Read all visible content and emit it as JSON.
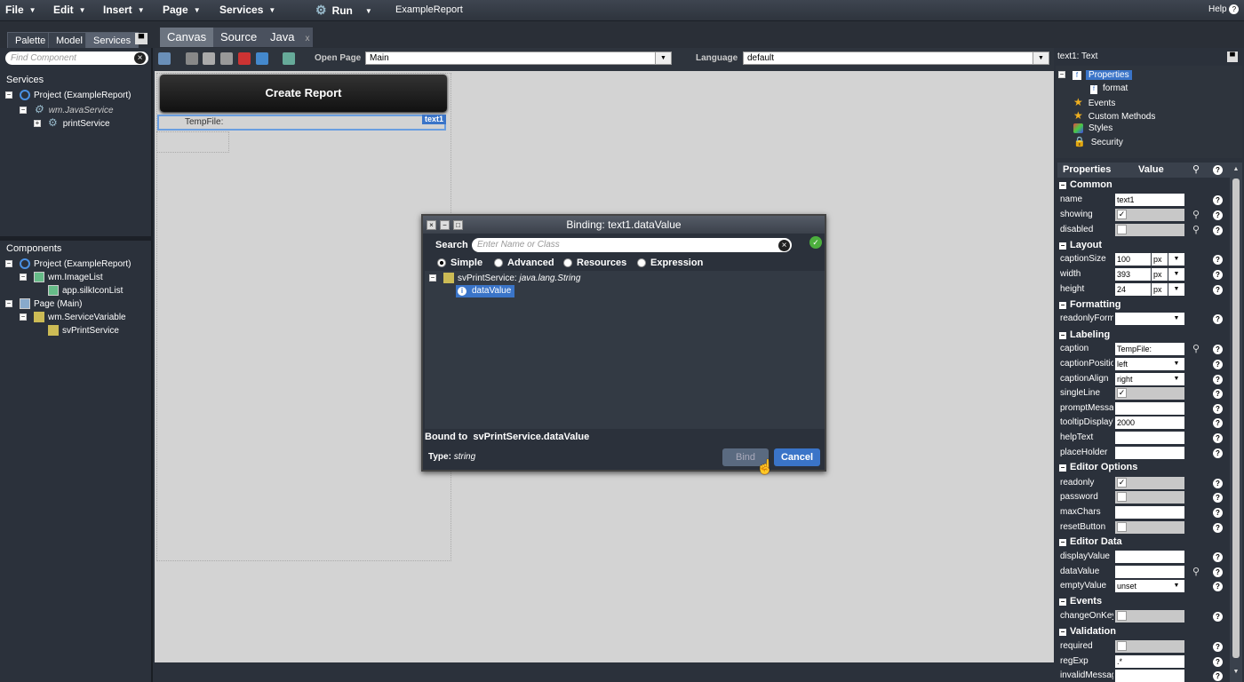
{
  "menu": {
    "file": "File",
    "edit": "Edit",
    "insert": "Insert",
    "page": "Page",
    "services": "Services",
    "run": "Run",
    "project": "ExampleReport",
    "help": "Help"
  },
  "left_tabs": {
    "palette": "Palette",
    "model": "Model",
    "services": "Services"
  },
  "editor_tabs": {
    "canvas": "Canvas",
    "source": "Source",
    "java": "Java"
  },
  "left_panel": {
    "search_placeholder": "Find Component",
    "services_title": "Services",
    "services_tree": [
      "Project (ExampleReport)",
      "wm.JavaService",
      "printService"
    ],
    "components_title": "Components",
    "components_tree": [
      "Project (ExampleReport)",
      "wm.ImageList",
      "app.silkIconList",
      "Page (Main)",
      "wm.ServiceVariable",
      "svPrintService"
    ]
  },
  "toolbar": {
    "open_page_label": "Open Page",
    "open_page_value": "Main",
    "language_label": "Language",
    "language_value": "default"
  },
  "canvas": {
    "create_button": "Create Report",
    "field_caption": "TempFile:",
    "field_tag": "text1"
  },
  "dialog": {
    "title": "Binding: text1.dataValue",
    "search_label": "Search",
    "search_placeholder": "Enter Name or Class",
    "modes": [
      "Simple",
      "Advanced",
      "Resources",
      "Expression"
    ],
    "selected_mode": "Simple",
    "tree_root": "svPrintService:",
    "tree_root_type": "java.lang.String",
    "tree_child": "dataValue",
    "bound_to_label": "Bound to",
    "bound_to_value": "svPrintService.dataValue",
    "type_label": "Type:",
    "type_value": "string",
    "bind_label": "Bind",
    "cancel_label": "Cancel"
  },
  "right_panel": {
    "title": "text1: Text",
    "tree": [
      "Properties",
      "format",
      "Events",
      "Custom Methods",
      "Styles",
      "Security"
    ],
    "header_properties": "Properties",
    "header_value": "Value",
    "groups": {
      "common": "Common",
      "layout": "Layout",
      "formatting": "Formatting",
      "labeling": "Labeling",
      "editor_options": "Editor Options",
      "editor_data": "Editor Data",
      "events": "Events",
      "validation": "Validation"
    },
    "props": {
      "name": {
        "label": "name",
        "value": "text1"
      },
      "showing": {
        "label": "showing",
        "value": "✓"
      },
      "disabled": {
        "label": "disabled",
        "value": ""
      },
      "captionSize": {
        "label": "captionSize",
        "value": "100",
        "unit": "px"
      },
      "width": {
        "label": "width",
        "value": "393",
        "unit": "px"
      },
      "height": {
        "label": "height",
        "value": "24",
        "unit": "px"
      },
      "readonlyFormatter": {
        "label": "readonlyForma",
        "value": ""
      },
      "caption": {
        "label": "caption",
        "value": "TempFile:"
      },
      "captionPosition": {
        "label": "captionPosition",
        "value": "left"
      },
      "captionAlign": {
        "label": "captionAlign",
        "value": "right"
      },
      "singleLine": {
        "label": "singleLine",
        "value": "✓"
      },
      "promptMessage": {
        "label": "promptMessag",
        "value": ""
      },
      "tooltipDisplayTime": {
        "label": "tooltipDisplayTi",
        "value": "2000"
      },
      "helpText": {
        "label": "helpText",
        "value": ""
      },
      "placeHolder": {
        "label": "placeHolder",
        "value": ""
      },
      "readonly": {
        "label": "readonly",
        "value": "✓"
      },
      "password": {
        "label": "password",
        "value": ""
      },
      "maxChars": {
        "label": "maxChars",
        "value": ""
      },
      "resetButton": {
        "label": "resetButton",
        "value": ""
      },
      "displayValue": {
        "label": "displayValue",
        "value": ""
      },
      "dataValue": {
        "label": "dataValue",
        "value": ""
      },
      "emptyValue": {
        "label": "emptyValue",
        "value": "unset"
      },
      "changeOnKey": {
        "label": "changeOnKey",
        "value": ""
      },
      "required": {
        "label": "required",
        "value": ""
      },
      "regExp": {
        "label": "regExp",
        "value": ".*"
      },
      "invalidMessage": {
        "label": "invalidMessag",
        "value": ""
      }
    }
  },
  "colors": {
    "accent": "#3a74c8",
    "ok": "#4caf3d",
    "dark_bg": "#2b313b",
    "canvas_bg": "#d3d3d3"
  }
}
